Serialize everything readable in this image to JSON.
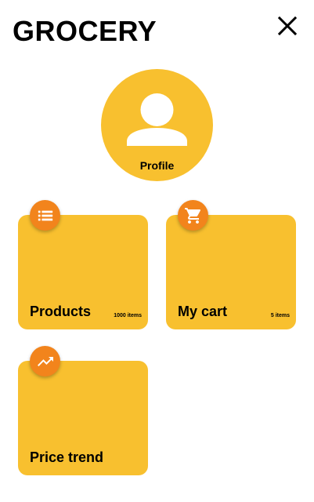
{
  "header": {
    "title": "GROCERY",
    "close_icon": "close-icon"
  },
  "profile": {
    "label": "Profile",
    "icon": "person-icon"
  },
  "cards": {
    "products": {
      "label": "Products",
      "count": "1000 items",
      "icon": "list-icon"
    },
    "cart": {
      "label": "My cart",
      "count": "5 items",
      "icon": "cart-icon"
    },
    "price_trend": {
      "label": "Price trend",
      "icon": "trending-up-icon"
    }
  },
  "colors": {
    "background": "#ffffff",
    "card": "#f8c02f",
    "badge": "#f2841c",
    "text": "#000000"
  }
}
